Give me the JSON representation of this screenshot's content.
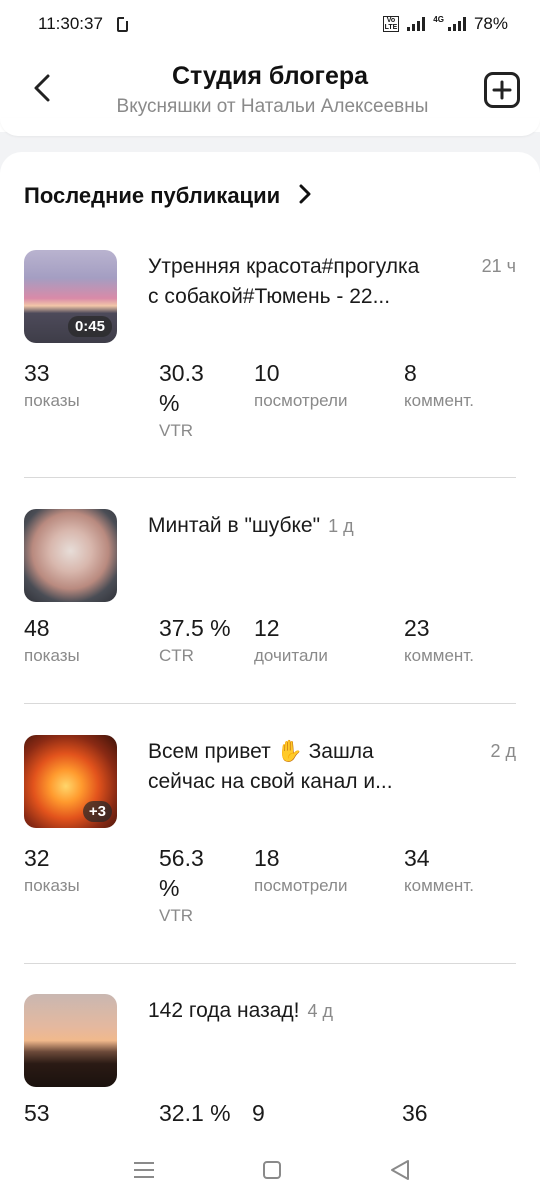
{
  "status_bar": {
    "time": "11:30:37",
    "network_tag": "4G",
    "battery": "78%"
  },
  "header": {
    "title": "Студия блогера",
    "subtitle": "Вкусняшки от Натальи Алексеевны"
  },
  "section": {
    "title": "Последние публикации"
  },
  "posts": [
    {
      "title_line1": "Утренняя красота#прогулка",
      "title_line2": "с собакой#Тюмень - 22...",
      "time": "21 ч",
      "badge": "0:45",
      "stats": [
        {
          "value_line1": "33",
          "value_line2": "",
          "label": "показы"
        },
        {
          "value_line1": "30.3",
          "value_line2": "%",
          "label": "VTR"
        },
        {
          "value_line1": "10",
          "value_line2": "",
          "label": "посмотрели"
        },
        {
          "value_line1": "8",
          "value_line2": "",
          "label": "коммент."
        }
      ]
    },
    {
      "title_line1": "Минтай в \"шубке\"",
      "time": "1 д",
      "stats": [
        {
          "value_line1": "48",
          "label": "показы"
        },
        {
          "value_line1": "37.5 %",
          "label": "CTR"
        },
        {
          "value_line1": "12",
          "label": "дочитали"
        },
        {
          "value_line1": "23",
          "label": "коммент."
        }
      ]
    },
    {
      "title_line1": "Всем привет ✋ Зашла",
      "title_line2": "сейчас на свой канал и...",
      "time": "2 д",
      "badge": "+3",
      "stats": [
        {
          "value_line1": "32",
          "value_line2": "",
          "label": "показы"
        },
        {
          "value_line1": "56.3",
          "value_line2": "%",
          "label": "VTR"
        },
        {
          "value_line1": "18",
          "value_line2": "",
          "label": "посмотрели"
        },
        {
          "value_line1": "34",
          "value_line2": "",
          "label": "коммент."
        }
      ]
    },
    {
      "title_line1": "142 года назад!",
      "time": "4 д",
      "stats": [
        {
          "value_line1": "53"
        },
        {
          "value_line1": "32.1 %"
        },
        {
          "value_line1": "9"
        },
        {
          "value_line1": "36"
        }
      ]
    }
  ],
  "colors": {
    "background": "#f2f3f5",
    "card": "#ffffff",
    "text_primary": "#1a1a1a",
    "text_secondary": "#8a8a8a",
    "divider": "#d9d9d9"
  },
  "icons": [
    "back-arrow-icon",
    "add-square-icon",
    "chevron-right-icon",
    "menu-icon",
    "home-square-icon",
    "back-triangle-icon"
  ]
}
